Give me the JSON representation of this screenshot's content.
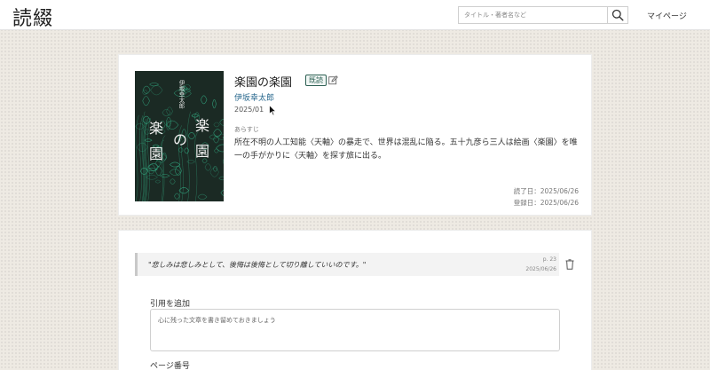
{
  "header": {
    "logo": "読綴",
    "search_placeholder": "タイトル・著者名など",
    "mypage_label": "マイページ"
  },
  "book": {
    "title": "楽園の楽園",
    "status": "既読",
    "author": "伊坂幸太郎",
    "published": "2025/01",
    "synopsis_label": "あらすじ",
    "synopsis": "所在不明の人工知能〈天軸〉の暴走で、世界は混乱に陥る。五十九彦ら三人は絵画〈楽園〉を唯一の手がかりに〈天軸〉を探す旅に出る。",
    "read_date": "読了日：2025/06/26",
    "registered_date": "登録日：2025/06/26",
    "cover": {
      "author_vertical": "伊坂幸太郎",
      "title_chars": [
        "楽",
        "園",
        "の",
        "楽",
        "園"
      ],
      "bg_color": "#1b2a24",
      "art_color": "#35b58a"
    }
  },
  "quotes": [
    {
      "text": "\"悲しみは悲しみとして、後悔は後悔として切り離していいのです。\"",
      "page": "p. 23",
      "date": "2025/06/26"
    }
  ],
  "add_quote": {
    "label": "引用を追加",
    "placeholder": "心に残った文章を書き留めておきましょう",
    "page_label": "ページ番号"
  },
  "colors": {
    "accent": "#2c5f52",
    "link": "#2b6a8f",
    "background": "#eeeae3"
  }
}
